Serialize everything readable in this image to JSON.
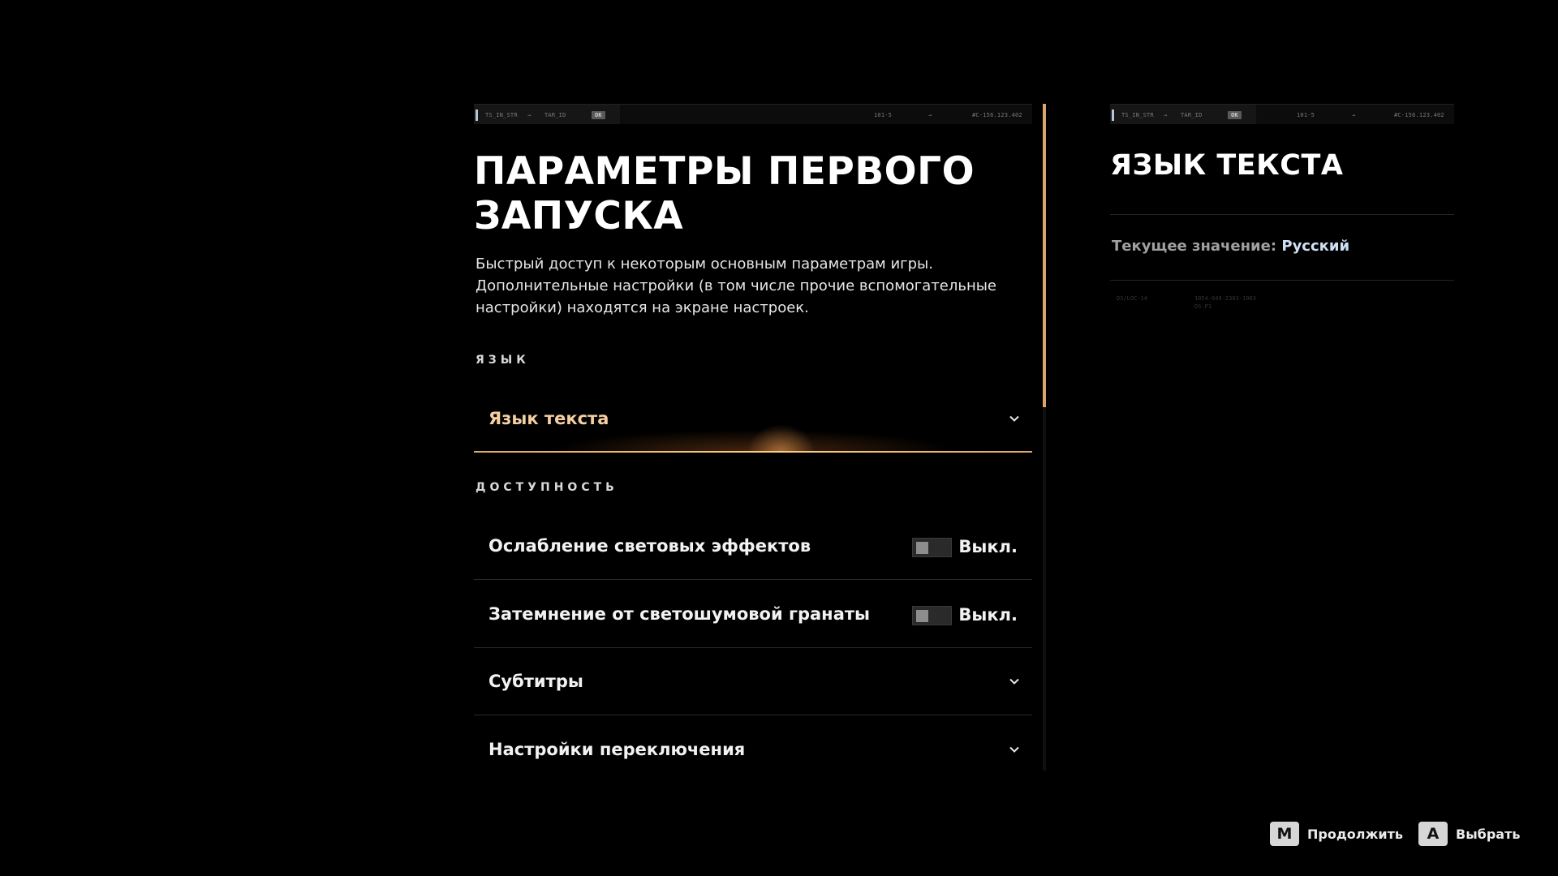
{
  "hud": {
    "code_left": "TS_IN_STR",
    "arrow_left": "→",
    "code_mid": "TAR_ID",
    "ok": "OK",
    "code_num": "101-5",
    "arrow_right": "→",
    "code_addr": "#C-156.123.402"
  },
  "main": {
    "title": "ПАРАМЕТРЫ ПЕРВОГО\nЗАПУСКА",
    "description": "Быстрый доступ к некоторым основным параметрам игры.\nДополнительные настройки (в том числе прочие вспомогательные\nнастройки) находятся на экране настроек.",
    "sections": {
      "language": {
        "label": "ЯЗЫК",
        "items": [
          {
            "label": "Язык текста",
            "type": "dropdown"
          }
        ]
      },
      "accessibility": {
        "label": "ДОСТУПНОСТЬ",
        "items": [
          {
            "label": "Ослабление световых эффектов",
            "type": "toggle",
            "value": "Выкл."
          },
          {
            "label": "Затемнение от светошумовой гранаты",
            "type": "toggle",
            "value": "Выкл."
          },
          {
            "label": "Субтитры",
            "type": "dropdown"
          },
          {
            "label": "Настройки переключения",
            "type": "dropdown"
          }
        ]
      }
    }
  },
  "detail": {
    "title": "ЯЗЫК ТЕКСТА",
    "current_label": "Текущее значение:",
    "current_value": "Русский",
    "meta_code": "DS/LOC-14",
    "meta_id": "1054-649-2303-1983",
    "meta_sub": "DS-P1"
  },
  "prompts": {
    "continue_key": "M",
    "continue_label": "Продолжить",
    "select_key": "A",
    "select_label": "Выбрать"
  },
  "colors": {
    "accent": "#d9a56b",
    "active_text": "#f4cfa2",
    "value_highlight": "#cfe0f5"
  }
}
